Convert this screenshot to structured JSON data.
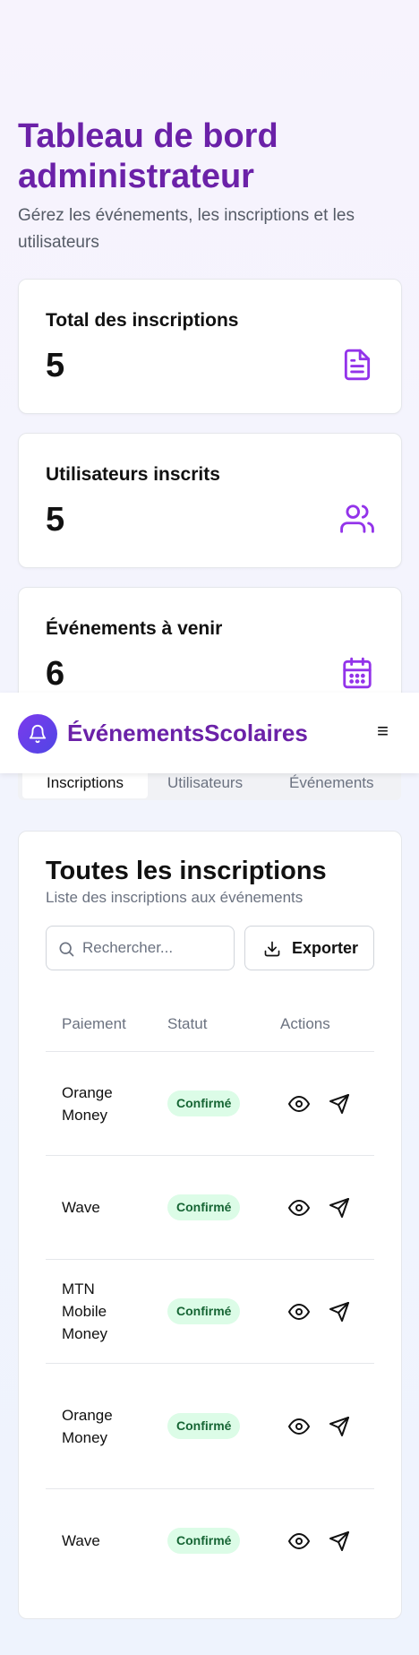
{
  "page": {
    "title": "Tableau de bord administrateur",
    "subtitle": "Gérez les événements, les inscriptions et les utilisateurs"
  },
  "stats": [
    {
      "label": "Total des inscriptions",
      "value": "5",
      "icon": "file-text-icon"
    },
    {
      "label": "Utilisateurs inscrits",
      "value": "5",
      "icon": "users-icon"
    },
    {
      "label": "Événements à venir",
      "value": "6",
      "icon": "calendar-icon"
    }
  ],
  "navbar": {
    "brand": "ÉvénementsScolaires",
    "logo_icon": "bell-icon",
    "menu_icon": "≡"
  },
  "tabs": [
    {
      "label": "Inscriptions",
      "active": true
    },
    {
      "label": "Utilisateurs",
      "active": false
    },
    {
      "label": "Événements",
      "active": false
    }
  ],
  "registrations": {
    "title": "Toutes les inscriptions",
    "subtitle": "Liste des inscriptions aux événements",
    "search_placeholder": "Rechercher...",
    "export_label": "Exporter",
    "columns": [
      "Paiement",
      "Statut",
      "Actions"
    ],
    "rows": [
      {
        "payment": "Orange Money",
        "status": "Confirmé"
      },
      {
        "payment": "Wave",
        "status": "Confirmé"
      },
      {
        "payment": "MTN Mobile Money",
        "status": "Confirmé"
      },
      {
        "payment": "Orange Money",
        "status": "Confirmé"
      },
      {
        "payment": "Wave",
        "status": "Confirmé"
      }
    ]
  },
  "colors": {
    "brand_purple": "#6b21a8",
    "icon_purple": "#9333ea",
    "badge_bg": "#dcfce7",
    "badge_text": "#166534"
  }
}
